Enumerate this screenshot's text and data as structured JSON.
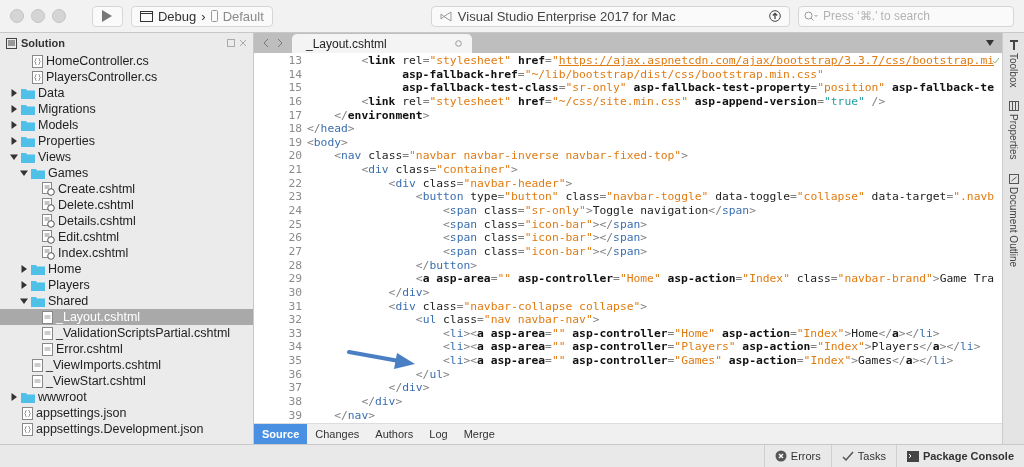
{
  "toolbar": {
    "configuration": "Debug",
    "separator": "›",
    "device": "Default",
    "status": "Visual Studio Enterprise 2017 for Mac",
    "search": {
      "placeholder": "Press ‘⌘.’ to search"
    }
  },
  "solution": {
    "title": "Solution",
    "overflow_children": [
      {
        "label": "HomeController.cs",
        "kind": "cs",
        "selected": false
      },
      {
        "label": "PlayersController.cs",
        "kind": "cs",
        "selected": false
      }
    ],
    "items": [
      {
        "label": "Data",
        "kind": "folder",
        "expanded": false,
        "selected": false
      },
      {
        "label": "Migrations",
        "kind": "folder",
        "expanded": false,
        "selected": false
      },
      {
        "label": "Models",
        "kind": "folder",
        "expanded": false,
        "selected": false
      },
      {
        "label": "Properties",
        "kind": "folder",
        "expanded": false,
        "selected": false
      },
      {
        "label": "Views",
        "kind": "folder",
        "expanded": true,
        "selected": false,
        "children": [
          {
            "label": "Games",
            "kind": "folder",
            "expanded": true,
            "selected": false,
            "children": [
              {
                "label": "Create.cshtml",
                "kind": "razor",
                "selected": false
              },
              {
                "label": "Delete.cshtml",
                "kind": "razor",
                "selected": false
              },
              {
                "label": "Details.cshtml",
                "kind": "razor",
                "selected": false
              },
              {
                "label": "Edit.cshtml",
                "kind": "razor",
                "selected": false
              },
              {
                "label": "Index.cshtml",
                "kind": "razor",
                "selected": false
              }
            ]
          },
          {
            "label": "Home",
            "kind": "folder",
            "expanded": false,
            "selected": false
          },
          {
            "label": "Players",
            "kind": "folder",
            "expanded": false,
            "selected": false
          },
          {
            "label": "Shared",
            "kind": "folder",
            "expanded": true,
            "selected": false,
            "children": [
              {
                "label": "_Layout.cshtml",
                "kind": "cshtml",
                "selected": true
              },
              {
                "label": "_ValidationScriptsPartial.cshtml",
                "kind": "cshtml",
                "selected": false
              },
              {
                "label": "Error.cshtml",
                "kind": "cshtml",
                "selected": false
              }
            ]
          },
          {
            "label": "_ViewImports.cshtml",
            "kind": "cshtml",
            "selected": false
          },
          {
            "label": "_ViewStart.cshtml",
            "kind": "cshtml",
            "selected": false
          }
        ]
      },
      {
        "label": "wwwroot",
        "kind": "folder",
        "expanded": false,
        "selected": false
      },
      {
        "label": "appsettings.json",
        "kind": "cs",
        "selected": false
      },
      {
        "label": "appsettings.Development.json",
        "kind": "cs",
        "selected": false
      }
    ]
  },
  "editor": {
    "tabs": [
      {
        "label": "_Layout.cshtml",
        "selected": true
      }
    ],
    "lines": [
      {
        "number": "13",
        "tokens": [
          {
            "kind": "punct",
            "text": "        <"
          },
          {
            "kind": "helper",
            "text": "link "
          },
          {
            "kind": "attr",
            "text": "rel"
          },
          {
            "kind": "punct",
            "text": "="
          },
          {
            "kind": "value",
            "text": "\"stylesheet\" "
          },
          {
            "kind": "bold",
            "text": "href"
          },
          {
            "kind": "punct",
            "text": "="
          },
          {
            "kind": "value",
            "text": "\""
          },
          {
            "kind": "link",
            "text": "https://ajax.aspnetcdn.com/ajax/bootstrap/3.3.7/css/bootstrap.mi"
          }
        ]
      },
      {
        "number": "14",
        "tokens": [
          {
            "kind": "bold",
            "text": "              asp-fallback-href"
          },
          {
            "kind": "punct",
            "text": "="
          },
          {
            "kind": "value",
            "text": "\"~/lib/bootstrap/dist/css/bootstrap.min.css\""
          }
        ]
      },
      {
        "number": "15",
        "tokens": [
          {
            "kind": "bold",
            "text": "              asp-fallback-test-class"
          },
          {
            "kind": "punct",
            "text": "="
          },
          {
            "kind": "value",
            "text": "\"sr-only\" "
          },
          {
            "kind": "bold",
            "text": "asp-fallback-test-property"
          },
          {
            "kind": "punct",
            "text": "="
          },
          {
            "kind": "value",
            "text": "\"position\" "
          },
          {
            "kind": "bold",
            "text": "asp-fallback-te"
          }
        ]
      },
      {
        "number": "16",
        "tokens": [
          {
            "kind": "punct",
            "text": "        <"
          },
          {
            "kind": "helper",
            "text": "link "
          },
          {
            "kind": "attr",
            "text": "rel"
          },
          {
            "kind": "punct",
            "text": "="
          },
          {
            "kind": "value",
            "text": "\"stylesheet\" "
          },
          {
            "kind": "bold",
            "text": "href"
          },
          {
            "kind": "punct",
            "text": "="
          },
          {
            "kind": "value",
            "text": "\"~/css/site.min.css\" "
          },
          {
            "kind": "bold",
            "text": "asp-append-version"
          },
          {
            "kind": "punct",
            "text": "="
          },
          {
            "kind": "literal",
            "text": "\"true\" "
          },
          {
            "kind": "punct",
            "text": "/>"
          }
        ]
      },
      {
        "number": "17",
        "tokens": [
          {
            "kind": "punct",
            "text": "    </"
          },
          {
            "kind": "helper",
            "text": "environment"
          },
          {
            "kind": "punct",
            "text": ">"
          }
        ]
      },
      {
        "number": "18",
        "tokens": [
          {
            "kind": "punct",
            "text": "</"
          },
          {
            "kind": "tag",
            "text": "head"
          },
          {
            "kind": "punct",
            "text": ">"
          }
        ]
      },
      {
        "number": "19",
        "tokens": [
          {
            "kind": "punct",
            "text": "<"
          },
          {
            "kind": "tag",
            "text": "body"
          },
          {
            "kind": "punct",
            "text": ">"
          }
        ]
      },
      {
        "number": "20",
        "tokens": [
          {
            "kind": "punct",
            "text": "    <"
          },
          {
            "kind": "tag",
            "text": "nav "
          },
          {
            "kind": "attr",
            "text": "class"
          },
          {
            "kind": "punct",
            "text": "="
          },
          {
            "kind": "value",
            "text": "\"navbar navbar-inverse navbar-fixed-top\""
          },
          {
            "kind": "punct",
            "text": ">"
          }
        ]
      },
      {
        "number": "21",
        "tokens": [
          {
            "kind": "punct",
            "text": "        <"
          },
          {
            "kind": "tag",
            "text": "div "
          },
          {
            "kind": "attr",
            "text": "class"
          },
          {
            "kind": "punct",
            "text": "="
          },
          {
            "kind": "value",
            "text": "\"container\""
          },
          {
            "kind": "punct",
            "text": ">"
          }
        ]
      },
      {
        "number": "22",
        "tokens": [
          {
            "kind": "punct",
            "text": "            <"
          },
          {
            "kind": "tag",
            "text": "div "
          },
          {
            "kind": "attr",
            "text": "class"
          },
          {
            "kind": "punct",
            "text": "="
          },
          {
            "kind": "value",
            "text": "\"navbar-header\""
          },
          {
            "kind": "punct",
            "text": ">"
          }
        ]
      },
      {
        "number": "23",
        "tokens": [
          {
            "kind": "punct",
            "text": "                <"
          },
          {
            "kind": "tag",
            "text": "button "
          },
          {
            "kind": "attr",
            "text": "type"
          },
          {
            "kind": "punct",
            "text": "="
          },
          {
            "kind": "value",
            "text": "\"button\" "
          },
          {
            "kind": "attr",
            "text": "class"
          },
          {
            "kind": "punct",
            "text": "="
          },
          {
            "kind": "value",
            "text": "\"navbar-toggle\" "
          },
          {
            "kind": "attr",
            "text": "data-toggle"
          },
          {
            "kind": "punct",
            "text": "="
          },
          {
            "kind": "value",
            "text": "\"collapse\" "
          },
          {
            "kind": "attr",
            "text": "data-target"
          },
          {
            "kind": "punct",
            "text": "="
          },
          {
            "kind": "value",
            "text": "\".navb"
          }
        ]
      },
      {
        "number": "24",
        "tokens": [
          {
            "kind": "punct",
            "text": "                    <"
          },
          {
            "kind": "tag",
            "text": "span "
          },
          {
            "kind": "attr",
            "text": "class"
          },
          {
            "kind": "punct",
            "text": "="
          },
          {
            "kind": "value",
            "text": "\"sr-only\""
          },
          {
            "kind": "punct",
            "text": ">"
          },
          {
            "kind": "text",
            "text": "Toggle navigation"
          },
          {
            "kind": "punct",
            "text": "</"
          },
          {
            "kind": "tag",
            "text": "span"
          },
          {
            "kind": "punct",
            "text": ">"
          }
        ]
      },
      {
        "number": "25",
        "tokens": [
          {
            "kind": "punct",
            "text": "                    <"
          },
          {
            "kind": "tag",
            "text": "span "
          },
          {
            "kind": "attr",
            "text": "class"
          },
          {
            "kind": "punct",
            "text": "="
          },
          {
            "kind": "value",
            "text": "\"icon-bar\""
          },
          {
            "kind": "punct",
            "text": "></"
          },
          {
            "kind": "tag",
            "text": "span"
          },
          {
            "kind": "punct",
            "text": ">"
          }
        ]
      },
      {
        "number": "26",
        "tokens": [
          {
            "kind": "punct",
            "text": "                    <"
          },
          {
            "kind": "tag",
            "text": "span "
          },
          {
            "kind": "attr",
            "text": "class"
          },
          {
            "kind": "punct",
            "text": "="
          },
          {
            "kind": "value",
            "text": "\"icon-bar\""
          },
          {
            "kind": "punct",
            "text": "></"
          },
          {
            "kind": "tag",
            "text": "span"
          },
          {
            "kind": "punct",
            "text": ">"
          }
        ]
      },
      {
        "number": "27",
        "tokens": [
          {
            "kind": "punct",
            "text": "                    <"
          },
          {
            "kind": "tag",
            "text": "span "
          },
          {
            "kind": "attr",
            "text": "class"
          },
          {
            "kind": "punct",
            "text": "="
          },
          {
            "kind": "value",
            "text": "\"icon-bar\""
          },
          {
            "kind": "punct",
            "text": "></"
          },
          {
            "kind": "tag",
            "text": "span"
          },
          {
            "kind": "punct",
            "text": ">"
          }
        ]
      },
      {
        "number": "28",
        "tokens": [
          {
            "kind": "punct",
            "text": "                </"
          },
          {
            "kind": "tag",
            "text": "button"
          },
          {
            "kind": "punct",
            "text": ">"
          }
        ]
      },
      {
        "number": "29",
        "tokens": [
          {
            "kind": "punct",
            "text": "                <"
          },
          {
            "kind": "helper",
            "text": "a "
          },
          {
            "kind": "bold",
            "text": "asp-area"
          },
          {
            "kind": "punct",
            "text": "="
          },
          {
            "kind": "value",
            "text": "\"\" "
          },
          {
            "kind": "bold",
            "text": "asp-controller"
          },
          {
            "kind": "punct",
            "text": "="
          },
          {
            "kind": "value",
            "text": "\"Home\" "
          },
          {
            "kind": "bold",
            "text": "asp-action"
          },
          {
            "kind": "punct",
            "text": "="
          },
          {
            "kind": "value",
            "text": "\"Index\" "
          },
          {
            "kind": "attr",
            "text": "class"
          },
          {
            "kind": "punct",
            "text": "="
          },
          {
            "kind": "value",
            "text": "\"navbar-brand\""
          },
          {
            "kind": "punct",
            "text": ">"
          },
          {
            "kind": "text",
            "text": "Game Tra"
          }
        ]
      },
      {
        "number": "30",
        "tokens": [
          {
            "kind": "punct",
            "text": "            </"
          },
          {
            "kind": "tag",
            "text": "div"
          },
          {
            "kind": "punct",
            "text": ">"
          }
        ]
      },
      {
        "number": "31",
        "tokens": [
          {
            "kind": "punct",
            "text": "            <"
          },
          {
            "kind": "tag",
            "text": "div "
          },
          {
            "kind": "attr",
            "text": "class"
          },
          {
            "kind": "punct",
            "text": "="
          },
          {
            "kind": "value",
            "text": "\"navbar-collapse collapse\""
          },
          {
            "kind": "punct",
            "text": ">"
          }
        ]
      },
      {
        "number": "32",
        "tokens": [
          {
            "kind": "punct",
            "text": "                <"
          },
          {
            "kind": "tag",
            "text": "ul "
          },
          {
            "kind": "attr",
            "text": "class"
          },
          {
            "kind": "punct",
            "text": "="
          },
          {
            "kind": "value",
            "text": "\"nav navbar-nav\""
          },
          {
            "kind": "punct",
            "text": ">"
          }
        ]
      },
      {
        "number": "33",
        "tokens": [
          {
            "kind": "punct",
            "text": "                    <"
          },
          {
            "kind": "tag",
            "text": "li"
          },
          {
            "kind": "punct",
            "text": "><"
          },
          {
            "kind": "helper",
            "text": "a "
          },
          {
            "kind": "bold",
            "text": "asp-area"
          },
          {
            "kind": "punct",
            "text": "="
          },
          {
            "kind": "value",
            "text": "\"\" "
          },
          {
            "kind": "bold",
            "text": "asp-controller"
          },
          {
            "kind": "punct",
            "text": "="
          },
          {
            "kind": "value",
            "text": "\"Home\" "
          },
          {
            "kind": "bold",
            "text": "asp-action"
          },
          {
            "kind": "punct",
            "text": "="
          },
          {
            "kind": "value",
            "text": "\"Index\""
          },
          {
            "kind": "punct",
            "text": ">"
          },
          {
            "kind": "text",
            "text": "Home"
          },
          {
            "kind": "punct",
            "text": "</"
          },
          {
            "kind": "helper",
            "text": "a"
          },
          {
            "kind": "punct",
            "text": "></"
          },
          {
            "kind": "tag",
            "text": "li"
          },
          {
            "kind": "punct",
            "text": ">"
          }
        ]
      },
      {
        "number": "34",
        "tokens": [
          {
            "kind": "punct",
            "text": "                    <"
          },
          {
            "kind": "tag",
            "text": "li"
          },
          {
            "kind": "punct",
            "text": "><"
          },
          {
            "kind": "helper",
            "text": "a "
          },
          {
            "kind": "bold",
            "text": "asp-area"
          },
          {
            "kind": "punct",
            "text": "="
          },
          {
            "kind": "value",
            "text": "\"\" "
          },
          {
            "kind": "bold",
            "text": "asp-controller"
          },
          {
            "kind": "punct",
            "text": "="
          },
          {
            "kind": "value",
            "text": "\"Players\" "
          },
          {
            "kind": "bold",
            "text": "asp-action"
          },
          {
            "kind": "punct",
            "text": "="
          },
          {
            "kind": "value",
            "text": "\"Index\""
          },
          {
            "kind": "punct",
            "text": ">"
          },
          {
            "kind": "text",
            "text": "Players"
          },
          {
            "kind": "punct",
            "text": "</"
          },
          {
            "kind": "helper",
            "text": "a"
          },
          {
            "kind": "punct",
            "text": "></"
          },
          {
            "kind": "tag",
            "text": "li"
          },
          {
            "kind": "punct",
            "text": ">"
          }
        ]
      },
      {
        "number": "35",
        "tokens": [
          {
            "kind": "punct",
            "text": "                    <"
          },
          {
            "kind": "tag",
            "text": "li"
          },
          {
            "kind": "punct",
            "text": "><"
          },
          {
            "kind": "helper",
            "text": "a "
          },
          {
            "kind": "bold",
            "text": "asp-area"
          },
          {
            "kind": "punct",
            "text": "="
          },
          {
            "kind": "value",
            "text": "\"\" "
          },
          {
            "kind": "bold",
            "text": "asp-controller"
          },
          {
            "kind": "punct",
            "text": "="
          },
          {
            "kind": "value",
            "text": "\"Games\" "
          },
          {
            "kind": "bold",
            "text": "asp-action"
          },
          {
            "kind": "punct",
            "text": "="
          },
          {
            "kind": "value",
            "text": "\"Index\""
          },
          {
            "kind": "punct",
            "text": ">"
          },
          {
            "kind": "text",
            "text": "Games"
          },
          {
            "kind": "punct",
            "text": "</"
          },
          {
            "kind": "helper",
            "text": "a"
          },
          {
            "kind": "punct",
            "text": "></"
          },
          {
            "kind": "tag",
            "text": "li"
          },
          {
            "kind": "punct",
            "text": ">"
          }
        ]
      },
      {
        "number": "36",
        "tokens": [
          {
            "kind": "punct",
            "text": "                </"
          },
          {
            "kind": "tag",
            "text": "ul"
          },
          {
            "kind": "punct",
            "text": ">"
          }
        ]
      },
      {
        "number": "37",
        "tokens": [
          {
            "kind": "punct",
            "text": "            </"
          },
          {
            "kind": "tag",
            "text": "div"
          },
          {
            "kind": "punct",
            "text": ">"
          }
        ]
      },
      {
        "number": "38",
        "tokens": [
          {
            "kind": "punct",
            "text": "        </"
          },
          {
            "kind": "tag",
            "text": "div"
          },
          {
            "kind": "punct",
            "text": ">"
          }
        ]
      },
      {
        "number": "39",
        "tokens": [
          {
            "kind": "punct",
            "text": "    </"
          },
          {
            "kind": "tag",
            "text": "nav"
          },
          {
            "kind": "punct",
            "text": ">"
          }
        ]
      }
    ],
    "view_tabs": [
      {
        "label": "Source",
        "selected": true
      },
      {
        "label": "Changes",
        "selected": false
      },
      {
        "label": "Authors",
        "selected": false
      },
      {
        "label": "Log",
        "selected": false
      },
      {
        "label": "Merge",
        "selected": false
      }
    ]
  },
  "side_pads": [
    {
      "label": "Toolbox",
      "kind": "toolbox"
    },
    {
      "label": "Properties",
      "kind": "properties"
    },
    {
      "label": "Document Outline",
      "kind": "outline"
    }
  ],
  "status_bar": [
    {
      "label": "Errors",
      "kind": "errors"
    },
    {
      "label": "Tasks",
      "kind": "tasks"
    },
    {
      "label": "Package Console",
      "kind": "console"
    }
  ]
}
